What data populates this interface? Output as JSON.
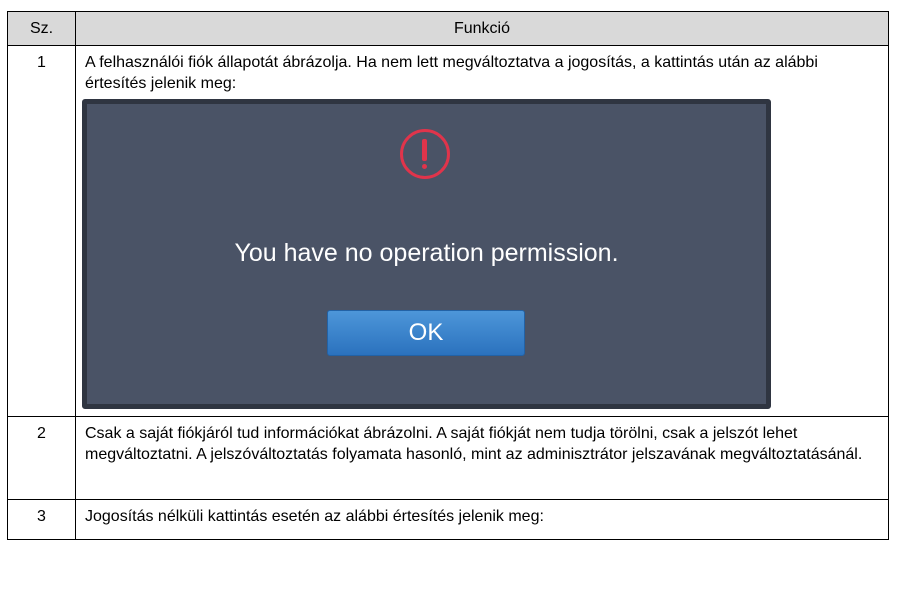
{
  "table": {
    "headers": [
      "Sz.",
      "Funkció"
    ],
    "rows": [
      {
        "num": "1",
        "text": "A felhasználói fiók állapotát ábrázolja. Ha nem lett megváltoztatva a jogosítás, a kattintás után az alábbi értesítés jelenik meg:",
        "dialog": {
          "icon": "exclamation-circle-icon",
          "message": "You have no operation permission.",
          "button_label": "OK",
          "background_color": "#4a5366",
          "icon_color": "#e0344b",
          "button_color": "#2f7dc8"
        }
      },
      {
        "num": "2",
        "text": "Csak a saját fiókjáról tud információkat ábrázolni. A saját fiókját nem tudja törölni, csak a jelszót lehet megváltoztatni. A jelszóváltoztatás folyamata hasonló, mint az adminisztrátor jelszavának megváltoztatásánál."
      },
      {
        "num": "3",
        "text": "Jogosítás nélküli kattintás esetén az alábbi értesítés jelenik meg:"
      }
    ]
  }
}
